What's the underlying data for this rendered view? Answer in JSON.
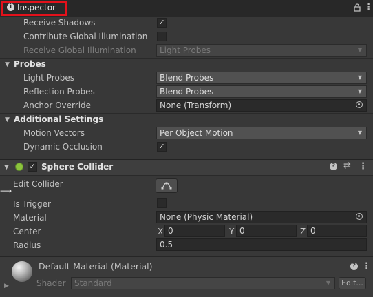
{
  "window": {
    "tab_title": "Inspector",
    "info_icon": "i",
    "lock_icon": "lock-icon",
    "menu_icon": "kebab-menu-icon"
  },
  "mesh_renderer": {
    "receive_shadows": {
      "label": "Receive Shadows",
      "checked": true
    },
    "contribute_gi": {
      "label": "Contribute Global Illumination",
      "checked": false
    },
    "receive_gi": {
      "label": "Receive Global Illumination",
      "value": "Light Probes"
    }
  },
  "probes": {
    "header": "Probes",
    "light_probes": {
      "label": "Light Probes",
      "value": "Blend Probes"
    },
    "reflection_probes": {
      "label": "Reflection Probes",
      "value": "Blend Probes"
    },
    "anchor_override": {
      "label": "Anchor Override",
      "value": "None (Transform)"
    }
  },
  "additional_settings": {
    "header": "Additional Settings",
    "motion_vectors": {
      "label": "Motion Vectors",
      "value": "Per Object Motion"
    },
    "dynamic_occlusion": {
      "label": "Dynamic Occlusion",
      "checked": true
    }
  },
  "sphere_collider": {
    "title": "Sphere Collider",
    "enabled": true,
    "edit_collider": {
      "label": "Edit Collider"
    },
    "is_trigger": {
      "label": "Is Trigger",
      "checked": false
    },
    "material": {
      "label": "Material",
      "value": "None (Physic Material)"
    },
    "center": {
      "label": "Center",
      "x_label": "X",
      "x": "0",
      "y_label": "Y",
      "y": "0",
      "z_label": "Z",
      "z": "0"
    },
    "radius": {
      "label": "Radius",
      "value": "0.5"
    }
  },
  "material_panel": {
    "name": "Default-Material (Material)",
    "shader_label": "Shader",
    "shader_value": "Standard",
    "edit_button": "Edit..."
  },
  "glyphs": {
    "check": "✓",
    "caret": "▼",
    "fold_open": "▼",
    "fold_closed": "▶",
    "kebab": "⋮",
    "help": "?",
    "settings": "⇄",
    "lock": "🔒"
  }
}
